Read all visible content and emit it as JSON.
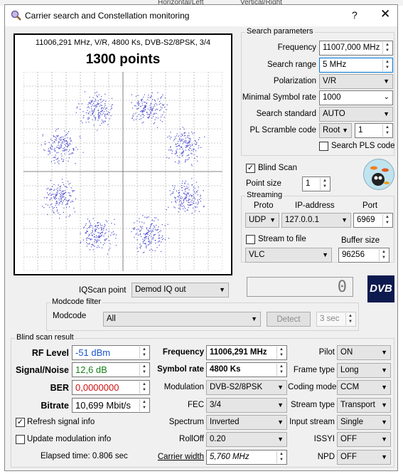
{
  "background": {
    "tab1": "Horizontal/Left",
    "tab2": "Vertical/Right"
  },
  "window": {
    "title": "Carrier search and Constellation monitoring",
    "help": "?",
    "close": "✕"
  },
  "constellation": {
    "info": "11006,291 MHz, V/R, 4800 Ks, DVB-S2/8PSK, 3/4",
    "points_label": "1300 points",
    "point_color": "#4a4ad0"
  },
  "search": {
    "title": "Search parameters",
    "frequency_label": "Frequency",
    "frequency_value": "11007,000 MHz",
    "range_label": "Search range",
    "range_value": "5 MHz",
    "polarization_label": "Polarization",
    "polarization_value": "V/R",
    "min_sr_label": "Minimal Symbol rate",
    "min_sr_value": "1000",
    "standard_label": "Search standard",
    "standard_value": "AUTO",
    "pls_label": "PL Scramble code",
    "pls_mode": "Root",
    "pls_value": "1",
    "search_pls_label": "Search PLS code"
  },
  "blind": {
    "label": "Blind Scan",
    "point_size_label": "Point size",
    "point_size_value": "1"
  },
  "streaming": {
    "title": "Streaming",
    "proto_label": "Proto",
    "proto_value": "UDP",
    "ip_label": "IP-address",
    "ip_value": "127.0.0.1",
    "port_label": "Port",
    "port_value": "6969",
    "file_label": "Stream to file",
    "buffer_label": "Buffer size",
    "player_value": "VLC",
    "buffer_value": "96256"
  },
  "counter": "0",
  "dvb_logo": "DVB",
  "iqscan": {
    "label": "IQScan point",
    "value": "Demod IQ out"
  },
  "modcode": {
    "title": "Modcode filter",
    "label": "Modcode",
    "value": "All",
    "detect": "Detect",
    "time": "3 sec"
  },
  "result": {
    "title": "Blind scan result",
    "rf_label": "RF Level",
    "rf_value": "-51 dBm",
    "rf_color": "#1a55d0",
    "snr_label": "Signal/Noise",
    "snr_value": "12,6 dB",
    "snr_color": "#1a7f1a",
    "ber_label": "BER",
    "ber_value": "0,0000000",
    "ber_color": "#d01010",
    "bitrate_label": "Bitrate",
    "bitrate_value": "10,699 Mbit/s",
    "freq_label": "Frequency",
    "freq_value": "11006,291 MHz",
    "sr_label": "Symbol rate",
    "sr_value": "4800 Ks",
    "mod_label": "Modulation",
    "mod_value": "DVB-S2/8PSK",
    "fec_label": "FEC",
    "fec_value": "3/4",
    "spectrum_label": "Spectrum",
    "spectrum_value": "Inverted",
    "rolloff_label": "RollOff",
    "rolloff_value": "0.20",
    "cw_label": "Carrier width",
    "cw_value": "5,760 MHz",
    "pilot_label": "Pilot",
    "pilot_value": "ON",
    "frame_label": "Frame type",
    "frame_value": "Long",
    "coding_label": "Coding mode",
    "coding_value": "CCM",
    "stype_label": "Stream type",
    "stype_value": "Transport",
    "istream_label": "Input stream",
    "istream_value": "Single",
    "issyi_label": "ISSYI",
    "issyi_value": "OFF",
    "npd_label": "NPD",
    "npd_value": "OFF",
    "refresh_label": "Refresh signal info",
    "update_label": "Update modulation info",
    "elapsed": "Elapsed time: 0.806 sec"
  }
}
